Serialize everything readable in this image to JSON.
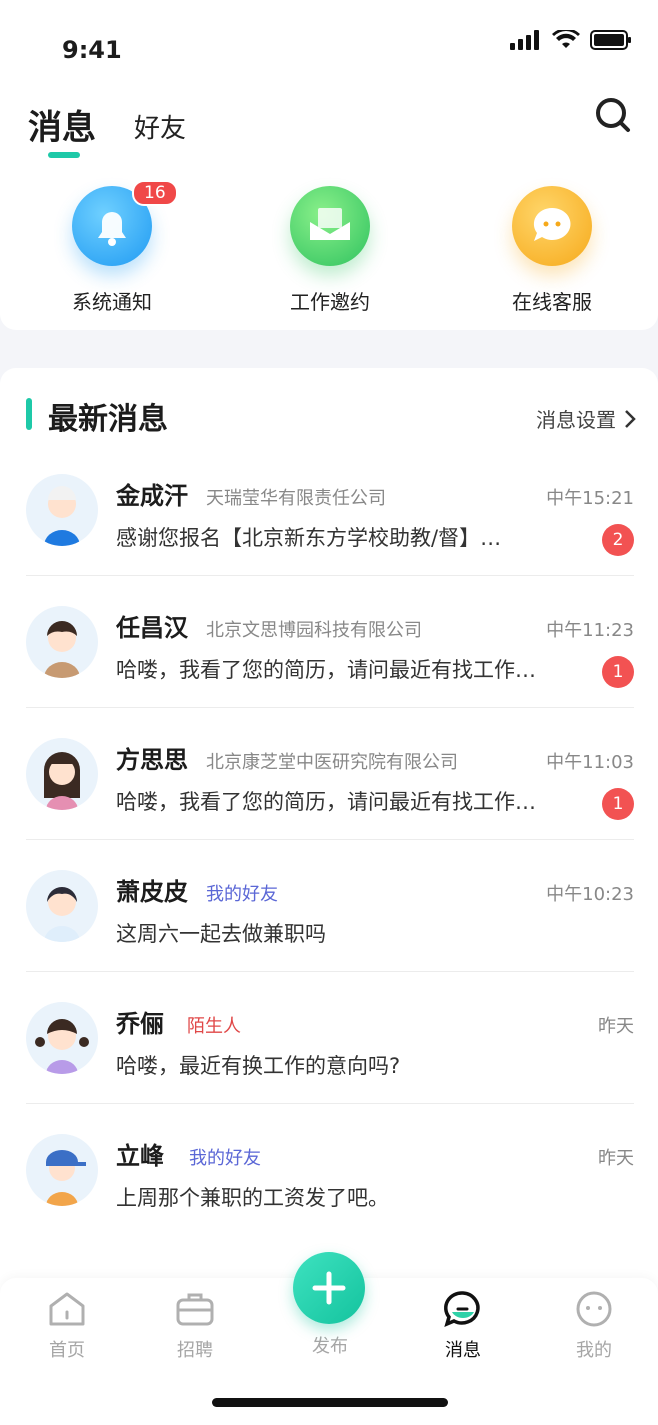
{
  "status": {
    "time": "9:41"
  },
  "header": {
    "tab_active": "消息",
    "tab_other": "好友"
  },
  "shortcuts": [
    {
      "label": "系统通知",
      "icon": "bell-icon",
      "badge": "16"
    },
    {
      "label": "工作邀约",
      "icon": "envelope-icon"
    },
    {
      "label": "在线客服",
      "icon": "chat-bubble-icon"
    }
  ],
  "section": {
    "title": "最新消息",
    "settings": "消息设置"
  },
  "messages": [
    {
      "name": "金成汗",
      "tag": "天瑞莹华有限责任公司",
      "time": "中午15:21",
      "text": "感谢您报名【北京新东方学校助教/督】…",
      "count": "2"
    },
    {
      "name": "任昌汉",
      "tag": "北京文思博园科技有限公司",
      "time": "中午11:23",
      "text": "哈喽，我看了您的简历，请问最近有找工作…",
      "count": "1"
    },
    {
      "name": "方思思",
      "tag": "北京康芝堂中医研究院有限公司",
      "time": "中午11:03",
      "text": "哈喽，我看了您的简历，请问最近有找工作…",
      "count": "1"
    },
    {
      "name": "萧皮皮",
      "tag": "我的好友",
      "time": "中午10:23",
      "text": "这周六一起去做兼职吗"
    },
    {
      "name": "乔俪",
      "tag": "陌生人",
      "time": "昨天",
      "text": "哈喽，最近有换工作的意向吗?"
    },
    {
      "name": "立峰",
      "tag": "我的好友",
      "time": "昨天",
      "text": "上周那个兼职的工资发了吧。"
    }
  ],
  "tag_colors": {
    "friend": "#5b67d6",
    "stranger": "#e04848",
    "company": "#888888"
  },
  "nav": [
    {
      "label": "首页",
      "icon": "home-icon"
    },
    {
      "label": "招聘",
      "icon": "briefcase-icon"
    },
    {
      "label": "发布",
      "icon": "plus-icon"
    },
    {
      "label": "消息",
      "icon": "message-icon",
      "active": true
    },
    {
      "label": "我的",
      "icon": "profile-icon"
    }
  ],
  "accent": "#1ec9a8"
}
